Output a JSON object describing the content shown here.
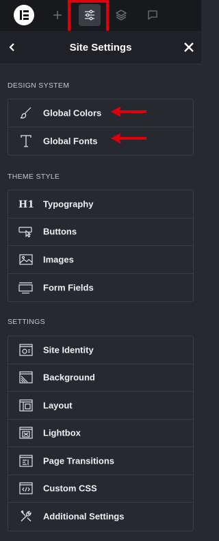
{
  "topbar": {
    "logo": "elementor-logo",
    "icons": [
      "plus-icon",
      "sliders-icon",
      "layers-icon",
      "comment-icon"
    ]
  },
  "header": {
    "title": "Site Settings",
    "back_icon": "chevron-left-icon",
    "close_icon": "close-icon"
  },
  "sections": [
    {
      "label": "DESIGN SYSTEM",
      "items": [
        {
          "label": "Global Colors",
          "icon": "brush-icon"
        },
        {
          "label": "Global Fonts",
          "icon": "font-t-icon"
        }
      ]
    },
    {
      "label": "THEME STYLE",
      "items": [
        {
          "label": "Typography",
          "icon": "h1-icon"
        },
        {
          "label": "Buttons",
          "icon": "button-cursor-icon"
        },
        {
          "label": "Images",
          "icon": "image-icon"
        },
        {
          "label": "Form Fields",
          "icon": "form-field-icon"
        }
      ]
    },
    {
      "label": "SETTINGS",
      "items": [
        {
          "label": "Site Identity",
          "icon": "site-identity-icon"
        },
        {
          "label": "Background",
          "icon": "background-icon"
        },
        {
          "label": "Layout",
          "icon": "layout-icon"
        },
        {
          "label": "Lightbox",
          "icon": "lightbox-icon"
        },
        {
          "label": "Page Transitions",
          "icon": "page-transitions-icon"
        },
        {
          "label": "Custom CSS",
          "icon": "custom-css-icon"
        },
        {
          "label": "Additional Settings",
          "icon": "tools-icon"
        }
      ]
    }
  ],
  "annotations": {
    "highlight_color": "#e0000b",
    "arrow_color": "#e0000b"
  }
}
